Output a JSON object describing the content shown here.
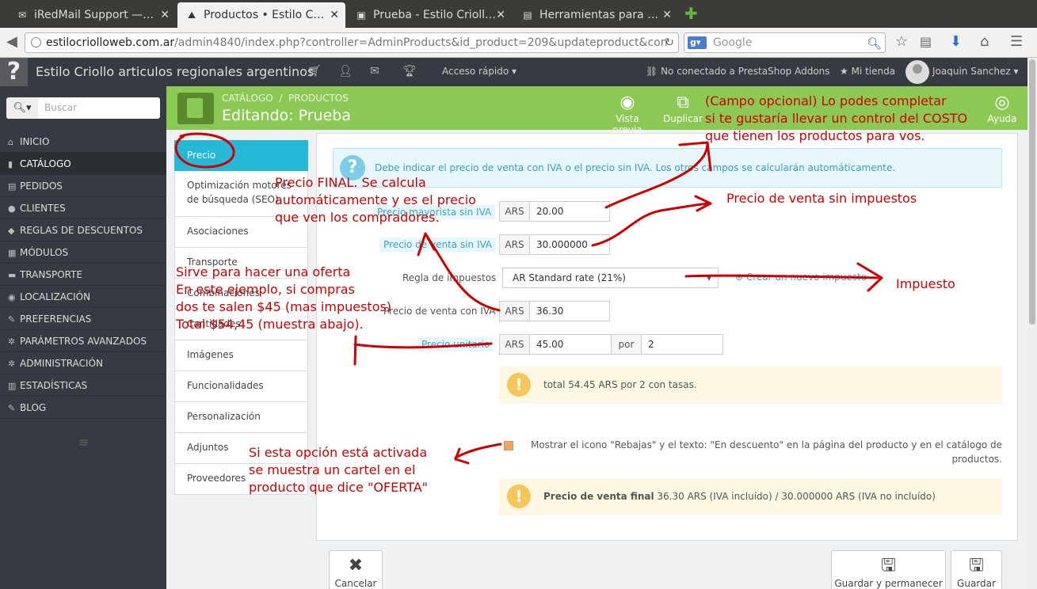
{
  "browser": {
    "tabs": [
      {
        "title": "iRedMail Support —…",
        "icon": "✉"
      },
      {
        "title": "Productos • Estilo C…",
        "icon": "⛰"
      },
      {
        "title": "Prueba - Estilo Crioll…",
        "icon": "▣"
      },
      {
        "title": "Herramientas para …",
        "icon": "▤"
      }
    ],
    "url_host": "estilocriolloweb.com.ar",
    "url_path": "/admin4840/index.php?controller=AdminProducts&id_product=209&updateproduct&con",
    "search_engine": "Google",
    "search_placeholder": "Google"
  },
  "header": {
    "help": "?",
    "shop_name": "Estilo Criollo articulos regionales argentinos",
    "quick_access": "Acceso rápido",
    "addons": "No conectado a PrestaShop Addons",
    "my_shop": "Mi tienda",
    "user": "Joaquin Sanchez"
  },
  "sidebar": {
    "search_placeholder": "Buscar",
    "items": [
      {
        "label": "INICIO",
        "icon": "⌂"
      },
      {
        "label": "CATÁLOGO",
        "icon": "▮"
      },
      {
        "label": "PEDIDOS",
        "icon": "▤"
      },
      {
        "label": "CLIENTES",
        "icon": "●"
      },
      {
        "label": "REGLAS DE DESCUENTOS",
        "icon": "◆"
      },
      {
        "label": "MÓDULOS",
        "icon": "▦"
      },
      {
        "label": "TRANSPORTE",
        "icon": "▬"
      },
      {
        "label": "LOCALIZACIÓN",
        "icon": "◉"
      },
      {
        "label": "PREFERENCIAS",
        "icon": "✎"
      },
      {
        "label": "PARÁMETROS AVANZADOS",
        "icon": "✲"
      },
      {
        "label": "ADMINISTRACIÓN",
        "icon": "✲"
      },
      {
        "label": "ESTADÍSTICAS",
        "icon": "▥"
      },
      {
        "label": "BLOG",
        "icon": "✎"
      }
    ]
  },
  "toolbar": {
    "breadcrumb_1": "CATÁLOGO",
    "breadcrumb_2": "PRODUCTOS",
    "title": "Editando: Prueba",
    "preview": "Vista previa",
    "duplicate": "Duplicar",
    "help": "Ayuda"
  },
  "product_tabs": [
    "Precio",
    "Optimización motores de búsqueda (SEO)",
    "Asociaciones",
    "Transporte",
    "Combinaciones",
    "Cantidades",
    "Imágenes",
    "Funcionalidades",
    "Personalización",
    "Adjuntos",
    "Proveedores"
  ],
  "form": {
    "info": "Debe indicar el precio de venta con IVA o el precio sin IVA. Los otros campos se calcularán automáticamente.",
    "wholesale_label": "Precio mayorista sin IVA",
    "currency": "ARS",
    "wholesale_value": "20.00",
    "price_label": "Precio de venta sin IVA",
    "price_value": "30.000000",
    "tax_label": "Regla de impuestos",
    "tax_value": "AR Standard rate (21%)",
    "new_tax_link": "Crear un nuevo impuesto",
    "price_tax_label": "Precio de venta con IVA",
    "price_tax_value": "36.30",
    "unit_label": "Precio unitario",
    "unit_value": "45.00",
    "per": "por",
    "unit_qty": "2",
    "unit_total": "total 54.45 ARS por 2 con tasas.",
    "on_sale_text": "Mostrar el icono \"Rebajas\" y el texto: \"En descuento\" en la página del producto y en el catálogo de productos.",
    "final_label": "Precio de venta final",
    "final_value": "36.30 ARS (IVA incluído) / 30.000000 ARS (IVA no incluído)"
  },
  "footer": {
    "cancel": "Cancelar",
    "save_stay": "Guardar y permanecer",
    "save": "Guardar"
  },
  "annotations": {
    "cost_1": "(Campo opcional) Lo podes completar",
    "cost_2": "si te gustaría llevar un control del COSTO",
    "cost_3": "que tienen los productos para vos.",
    "final_1": "Precio FINAL. Se calcula",
    "final_2": "automáticamente y es el precio",
    "final_3": "que ven los compradores.",
    "no_tax": "Precio de venta sin impuestos",
    "tax": "Impuesto",
    "offer_1": "Sirve para hacer una oferta",
    "offer_2": "En este ejemplo, si compras",
    "offer_3": "dos te salen $45 (mas impuestos)",
    "offer_4": "Total $54,45 (muestra abajo).",
    "sale_1": "Si esta opción está activada",
    "sale_2": "se muestra un cartel en el",
    "sale_3": "producto que dice \"OFERTA\""
  },
  "colors": {
    "accent": "#25b9d7",
    "toolbar": "#8bc954",
    "annotation": "#d10000",
    "sidebar": "#363a41"
  }
}
